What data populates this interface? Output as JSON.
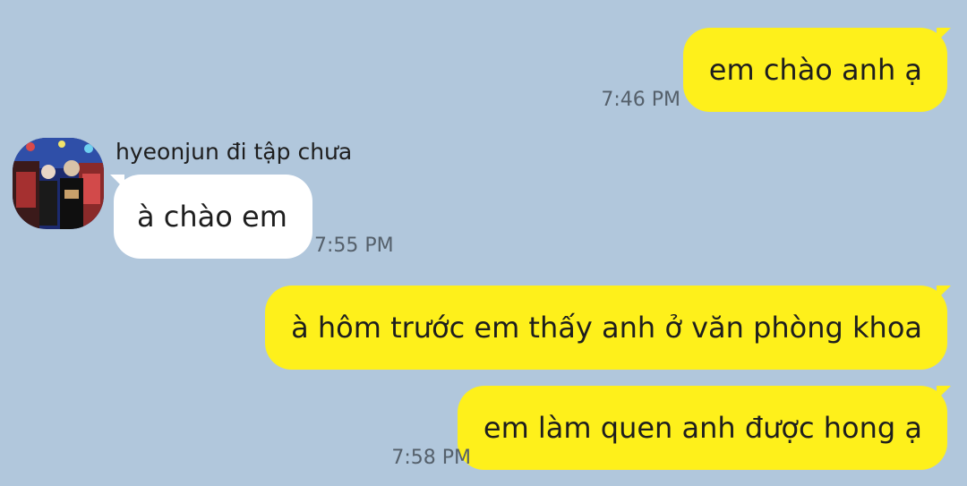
{
  "chat": {
    "background_color": "#b1c7dc",
    "outgoing_bubble_color": "#fef01b",
    "incoming_bubble_color": "#ffffff",
    "messages": [
      {
        "direction": "outgoing",
        "text": "em chào anh ạ",
        "time": "7:46 PM"
      },
      {
        "direction": "incoming",
        "sender": "hyeonjun đi tập chưa",
        "avatar": "profile-photo",
        "text": "à chào em",
        "time": "7:55 PM"
      },
      {
        "direction": "outgoing",
        "text": "à hôm trước em thấy anh ở văn phòng khoa",
        "time": ""
      },
      {
        "direction": "outgoing",
        "text": "em làm quen anh được hong ạ",
        "time": "7:58 PM"
      }
    ]
  }
}
